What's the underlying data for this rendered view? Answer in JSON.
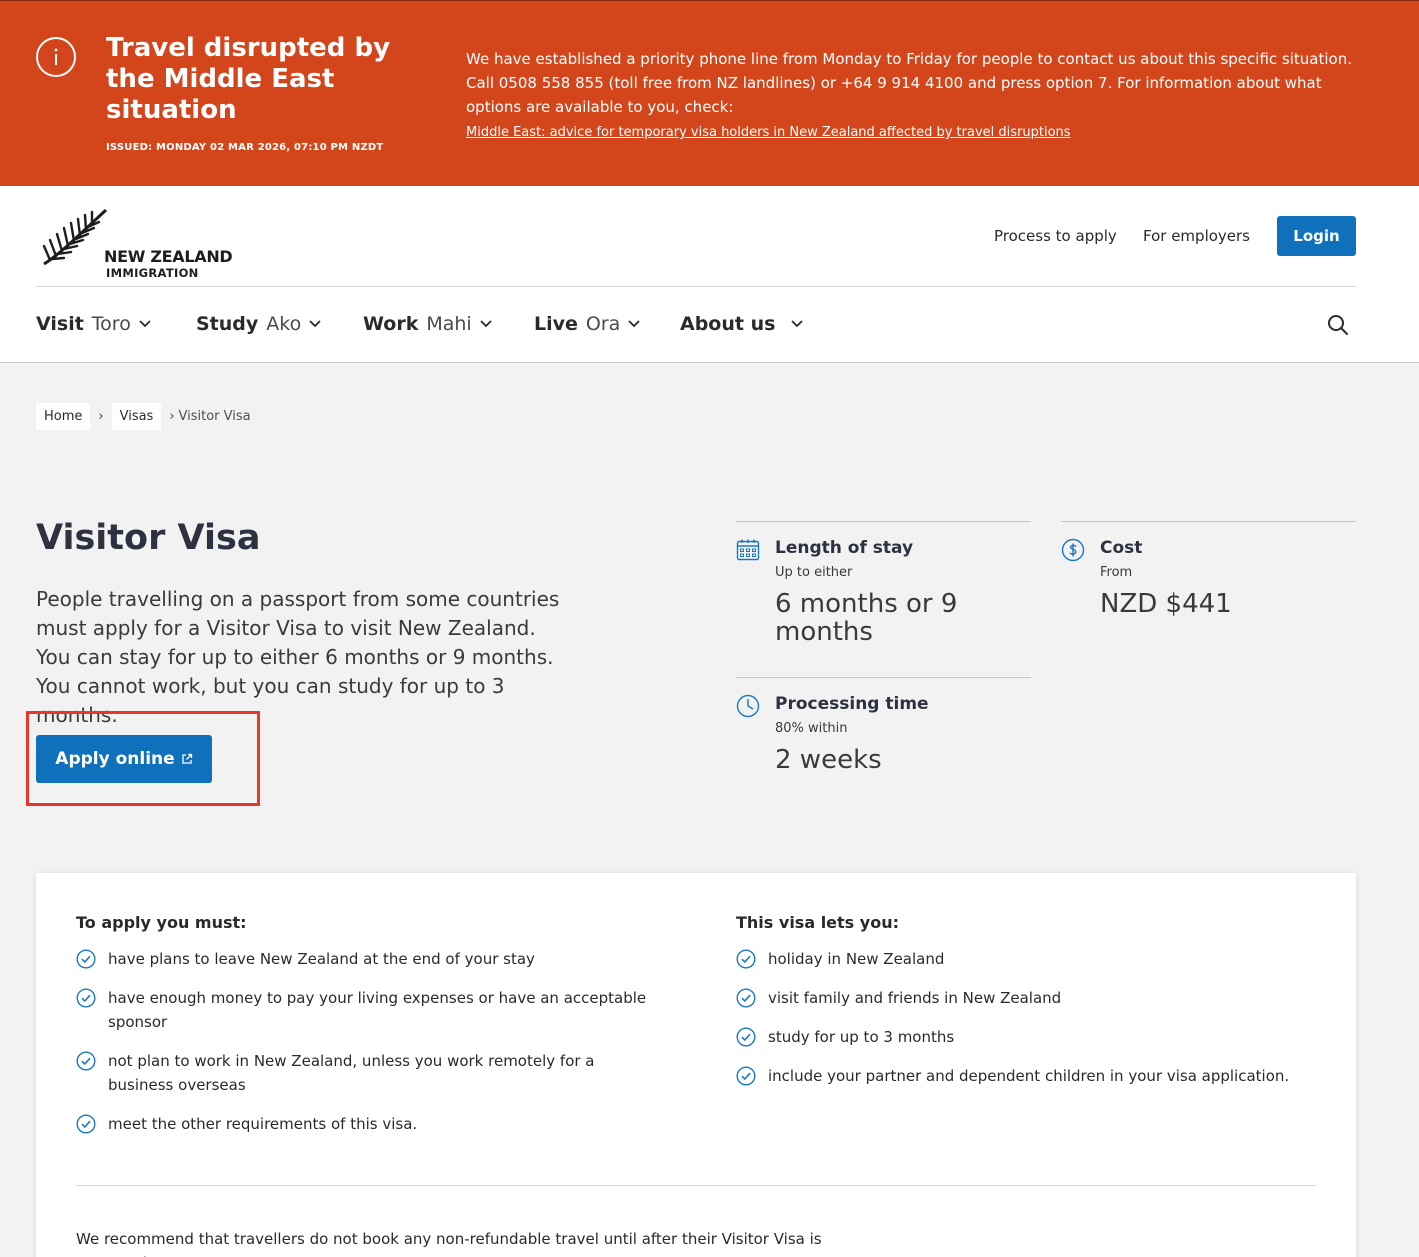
{
  "alert": {
    "title": "Travel disrupted by the Middle East situation",
    "issued": "ISSUED: MONDAY 02 MAR 2026, 07:10 PM NZDT",
    "body": "We have established a priority phone line from Monday to Friday for people to contact us about this specific situation. Call 0508 558 855 (toll free from NZ landlines) or +64 9 914 4100 and press option 7. For information about what options are available to you, check:",
    "link": "Middle East: advice for temporary visa holders in New Zealand affected by travel disruptions",
    "bg_color": "#d3461c"
  },
  "header": {
    "logo_line1": "NEW ZEALAND",
    "logo_line2": "IMMIGRATION",
    "process_link": "Process to apply",
    "employers_link": "For employers",
    "login": "Login"
  },
  "nav": [
    {
      "en": "Visit",
      "mi": "Toro"
    },
    {
      "en": "Study",
      "mi": "Ako"
    },
    {
      "en": "Work",
      "mi": "Mahi"
    },
    {
      "en": "Live",
      "mi": "Ora"
    },
    {
      "en": "About us",
      "mi": ""
    }
  ],
  "breadcrumb": {
    "home": "Home",
    "visas": "Visas",
    "current": "Visitor Visa"
  },
  "hero": {
    "title": "Visitor Visa",
    "intro": "People travelling on a passport from some countries must apply for a Visitor Visa to visit New Zealand. You can stay for up to either 6 months or 9 months. You cannot work, but you can study for up to 3 months.",
    "apply": "Apply online",
    "highlight_color": "#e8382a"
  },
  "facts": {
    "stay": {
      "label": "Length of stay",
      "qualifier": "Up to either",
      "value": "6 months or 9 months"
    },
    "cost": {
      "label": "Cost",
      "qualifier": "From",
      "value": "NZD $441"
    },
    "processing": {
      "label": "Processing time",
      "qualifier": "80% within",
      "value": "2 weeks"
    }
  },
  "requirements": {
    "title": "To apply you must:",
    "items": [
      "have plans to leave New Zealand at the end of your stay",
      "have enough money to pay your living expenses or have an acceptable sponsor",
      "not plan to work in New Zealand, unless you work remotely for a business overseas",
      "meet the other requirements of this visa."
    ]
  },
  "benefits": {
    "title": "This visa lets you:",
    "items": [
      "holiday in New Zealand",
      "visit family and friends in New Zealand",
      "study for up to 3 months",
      "include your partner and dependent children in your visa application."
    ]
  },
  "footnote": "We recommend that travellers do not book any non-refundable travel until after their Visitor Visa is approved.",
  "colors": {
    "primary": "#0f71bb",
    "icon_blue": "#1b78c0"
  }
}
